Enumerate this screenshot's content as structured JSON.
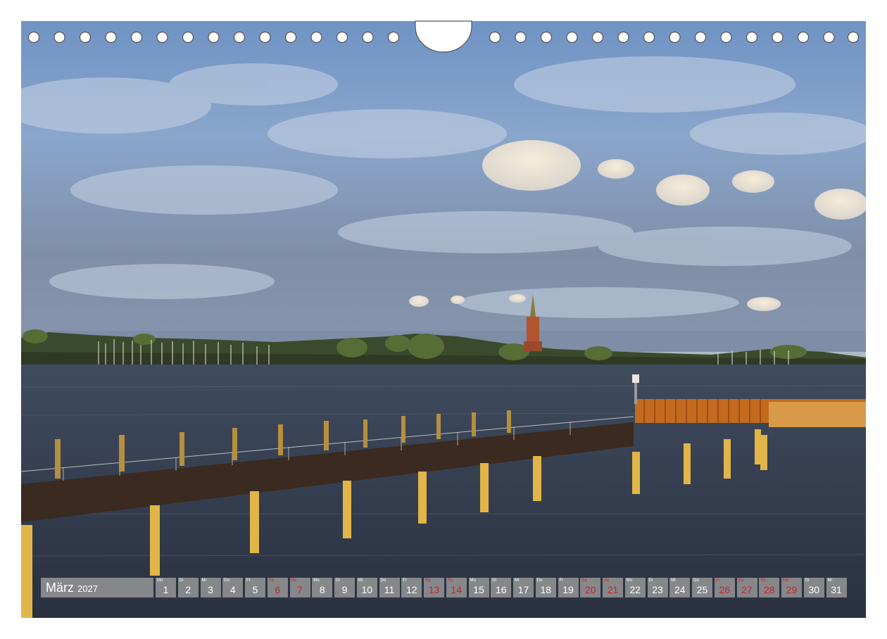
{
  "calendar": {
    "month": "März",
    "year": "2027",
    "days": [
      {
        "wd": "Mo",
        "n": "1",
        "red": false
      },
      {
        "wd": "Di",
        "n": "2",
        "red": false
      },
      {
        "wd": "Mi",
        "n": "3",
        "red": false
      },
      {
        "wd": "Do",
        "n": "4",
        "red": false
      },
      {
        "wd": "Fr",
        "n": "5",
        "red": false
      },
      {
        "wd": "Sa",
        "n": "6",
        "red": true
      },
      {
        "wd": "So",
        "n": "7",
        "red": true
      },
      {
        "wd": "Mo",
        "n": "8",
        "red": false
      },
      {
        "wd": "Di",
        "n": "9",
        "red": false
      },
      {
        "wd": "Mi",
        "n": "10",
        "red": false
      },
      {
        "wd": "Do",
        "n": "11",
        "red": false
      },
      {
        "wd": "Fr",
        "n": "12",
        "red": false
      },
      {
        "wd": "Sa",
        "n": "13",
        "red": true
      },
      {
        "wd": "So",
        "n": "14",
        "red": true
      },
      {
        "wd": "Mo",
        "n": "15",
        "red": false
      },
      {
        "wd": "Di",
        "n": "16",
        "red": false
      },
      {
        "wd": "Mi",
        "n": "17",
        "red": false
      },
      {
        "wd": "Do",
        "n": "18",
        "red": false
      },
      {
        "wd": "Fr",
        "n": "19",
        "red": false
      },
      {
        "wd": "Sa",
        "n": "20",
        "red": true
      },
      {
        "wd": "So",
        "n": "21",
        "red": true
      },
      {
        "wd": "Mo",
        "n": "22",
        "red": false
      },
      {
        "wd": "Di",
        "n": "23",
        "red": false
      },
      {
        "wd": "Mi",
        "n": "24",
        "red": false
      },
      {
        "wd": "Do",
        "n": "25",
        "red": false
      },
      {
        "wd": "Fr",
        "n": "26",
        "red": true
      },
      {
        "wd": "Sa",
        "n": "27",
        "red": true
      },
      {
        "wd": "So",
        "n": "28",
        "red": true
      },
      {
        "wd": "Mo",
        "n": "29",
        "red": true
      },
      {
        "wd": "Di",
        "n": "30",
        "red": false
      },
      {
        "wd": "Mi",
        "n": "31",
        "red": false
      }
    ]
  },
  "colors": {
    "weekday_text": "#ffffff",
    "holiday_text": "#d0202a",
    "cell_bg": "#969696"
  }
}
